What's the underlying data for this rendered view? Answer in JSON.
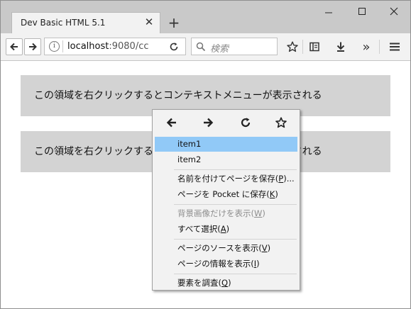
{
  "browser": {
    "tab_title": "Dev Basic HTML 5.1",
    "tab_close": "✕",
    "new_tab": "+",
    "window_minimize": "—",
    "window_maximize": "☐",
    "window_close": "✕",
    "url_host": "localhost",
    "url_rest": ":9080/cc",
    "info_glyph": "i",
    "search_placeholder": "検索",
    "overflow_glyph": "»"
  },
  "page": {
    "area1_text": "この領域を右クリックするとコンテキストメニューが表示される",
    "area2_text": "この領域を右クリックするとコンテキストメニューが表示される"
  },
  "context_menu": {
    "nav_icons": [
      "back-arrow",
      "forward-arrow",
      "reload",
      "bookmark-star"
    ],
    "items": [
      {
        "pre": "item1",
        "key": "",
        "post": "",
        "highlighted": true,
        "disabled": false
      },
      {
        "pre": "item2",
        "key": "",
        "post": "",
        "highlighted": false,
        "disabled": false
      },
      {
        "pre": "名前を付けてページを保存(",
        "key": "P",
        "post": ")...",
        "highlighted": false,
        "disabled": false
      },
      {
        "pre": "ページを Pocket に保存(",
        "key": "K",
        "post": ")",
        "highlighted": false,
        "disabled": false
      },
      {
        "pre": "背景画像だけを表示(",
        "key": "W",
        "post": ")",
        "highlighted": false,
        "disabled": true
      },
      {
        "pre": "すべて選択(",
        "key": "A",
        "post": ")",
        "highlighted": false,
        "disabled": false
      },
      {
        "pre": "ページのソースを表示(",
        "key": "V",
        "post": ")",
        "highlighted": false,
        "disabled": false
      },
      {
        "pre": "ページの情報を表示(",
        "key": "I",
        "post": ")",
        "highlighted": false,
        "disabled": false
      },
      {
        "pre": "要素を調査(",
        "key": "Q",
        "post": ")",
        "highlighted": false,
        "disabled": false
      }
    ]
  },
  "colors": {
    "highlight": "#91c9f7",
    "area_bg": "#d3d3d3",
    "menu_bg": "#f2f2f2",
    "titlebar_bg": "#c9c9c9"
  }
}
